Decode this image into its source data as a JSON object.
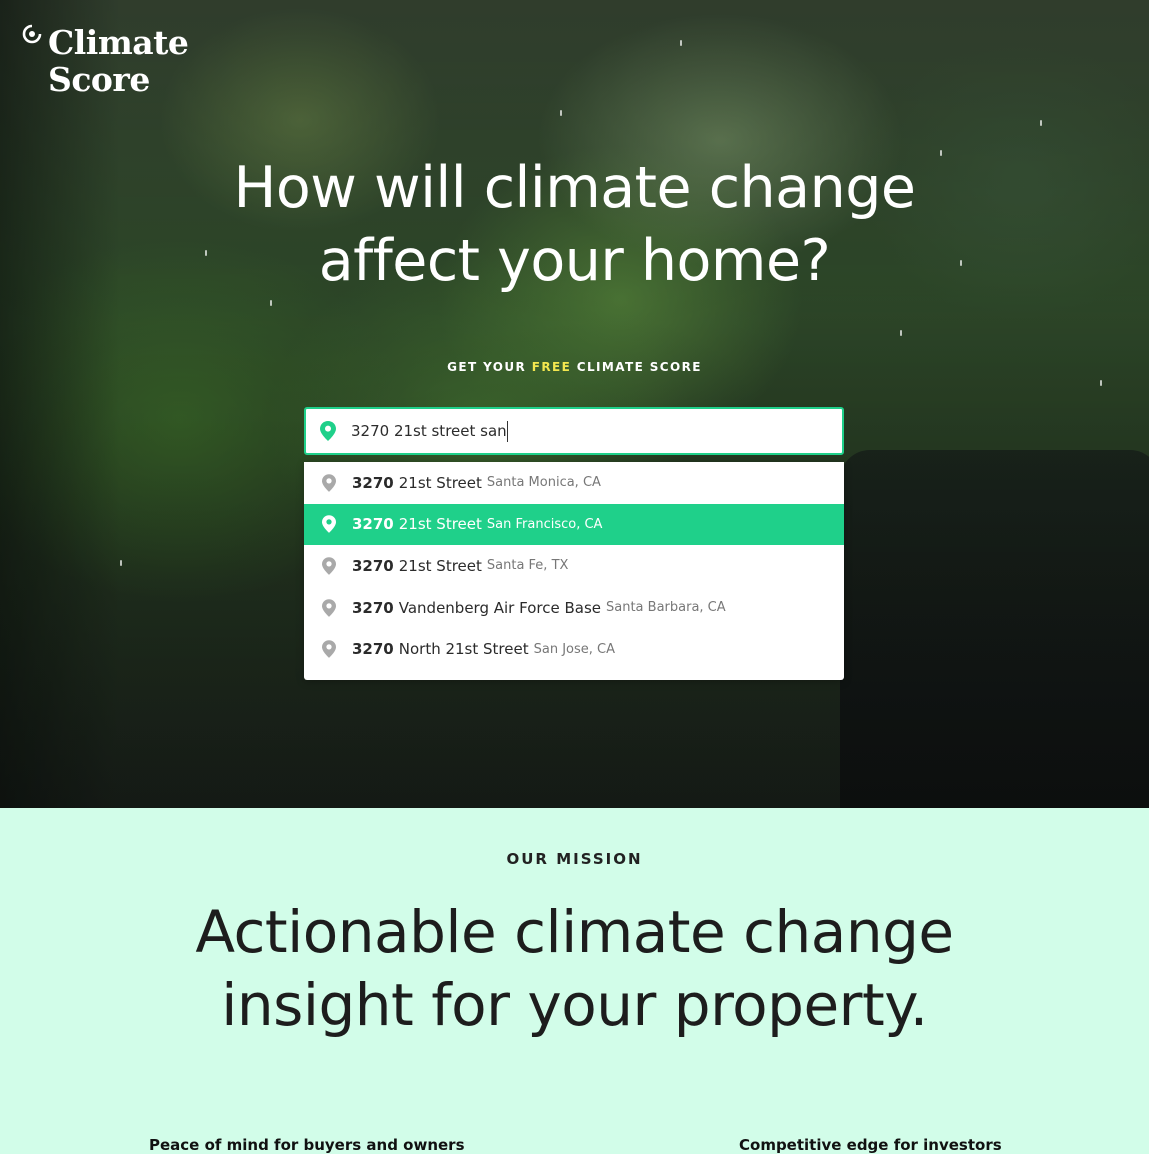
{
  "logo": {
    "text_line1": "Climate",
    "text_line2": "Score",
    "icon": "climate-score-logo-icon"
  },
  "hero": {
    "headline_line1": "How will climate change",
    "headline_line2": "affect your home?",
    "cta_prefix": "GET YOUR",
    "cta_highlight": "FREE",
    "cta_suffix": "CLIMATE SCORE",
    "highlight_color": "#f2e64f"
  },
  "search": {
    "value": "3270 21st street san",
    "icon": "location-pin-icon",
    "accent_color": "#1fd08a"
  },
  "suggestions": [
    {
      "number": "3270",
      "street": "21st Street",
      "city": "Santa Monica, CA",
      "active": false
    },
    {
      "number": "3270",
      "street": "21st Street",
      "city": "San Francisco, CA",
      "active": true
    },
    {
      "number": "3270",
      "street": "21st Street",
      "city": "Santa Fe, TX",
      "active": false
    },
    {
      "number": "3270",
      "street": "Vandenberg Air Force Base",
      "city": "Santa Barbara, CA",
      "active": false
    },
    {
      "number": "3270",
      "street": "North 21st Street",
      "city": "San Jose, CA",
      "active": false
    }
  ],
  "mission": {
    "label": "OUR MISSION",
    "heading_line1": "Actionable climate change",
    "heading_line2": "insight for your property.",
    "feature_left": "Peace of mind for buyers and owners",
    "feature_right": "Competitive edge for investors",
    "background_color": "#d2fde9"
  }
}
